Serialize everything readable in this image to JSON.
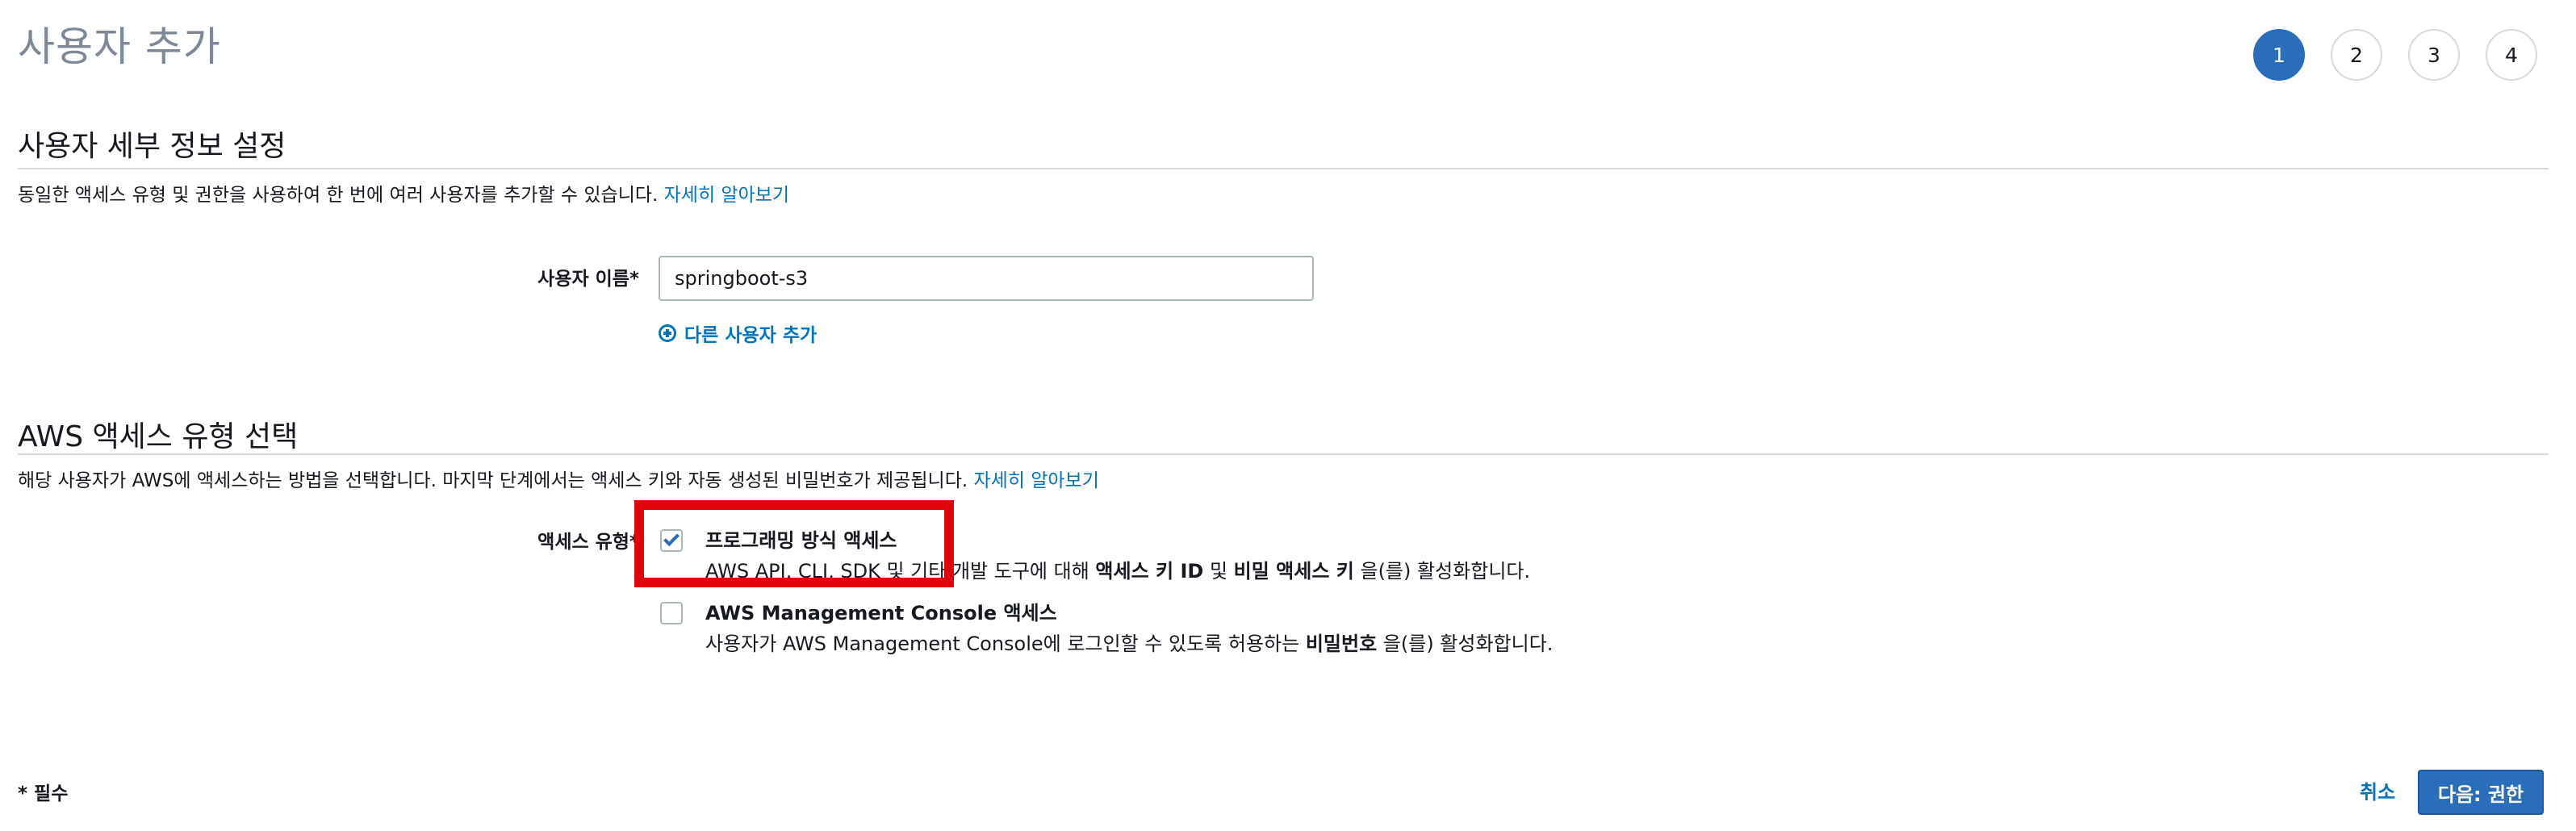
{
  "page": {
    "title": "사용자 추가",
    "steps": [
      "1",
      "2",
      "3",
      "4"
    ],
    "active_step": "1"
  },
  "details_section": {
    "title": "사용자 세부 정보 설정",
    "description": "동일한 액세스 유형 및 권한을 사용하여 한 번에 여러 사용자를 추가할 수 있습니다.",
    "learn_more": "자세히 알아보기",
    "username_label": "사용자 이름*",
    "username_value": "springboot-s3",
    "add_another_user": "다른 사용자 추가"
  },
  "access_section": {
    "title": "AWS 액세스 유형 선택",
    "description": "해당 사용자가 AWS에 액세스하는 방법을 선택합니다. 마지막 단계에서는 액세스 키와 자동 생성된 비밀번호가 제공됩니다.",
    "learn_more": "자세히 알아보기",
    "access_type_label": "액세스 유형*",
    "options": [
      {
        "title": "프로그래밍 방식 액세스",
        "checked": true,
        "desc_prefix": "AWS API, CLI, SDK 및 기타 개발 도구에 대해 ",
        "desc_bold1": "액세스 키 ID",
        "desc_mid": " 및 ",
        "desc_bold2": "비밀 액세스 키",
        "desc_suffix": " 을(를) 활성화합니다."
      },
      {
        "title": "AWS Management Console 액세스",
        "checked": false,
        "desc_prefix": "사용자가 AWS Management Console에 로그인할 수 있도록 허용하는 ",
        "desc_bold1": "비밀번호",
        "desc_suffix": " 을(를) 활성화합니다."
      }
    ]
  },
  "footer": {
    "required_note": "* 필수",
    "cancel_label": "취소",
    "next_label": "다음: 권한"
  },
  "colors": {
    "accent": "#2a6ebb",
    "link": "#0073bb",
    "highlight": "#e0040b"
  }
}
